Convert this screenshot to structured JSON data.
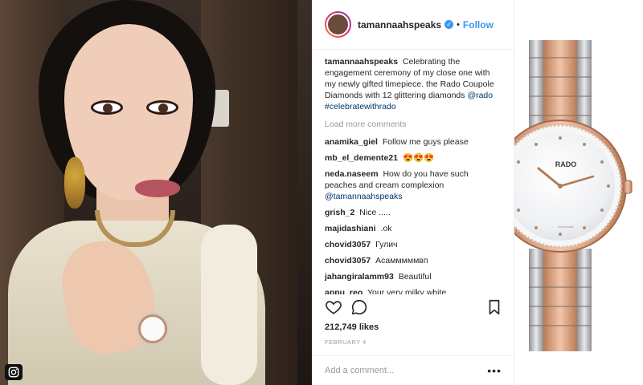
{
  "post": {
    "username": "tamannaahspeaks",
    "follow_label": "Follow",
    "caption": {
      "user": "tamannaahspeaks",
      "text": "Celebrating the engagement ceremony of my close one with my newly gifted timepiece. the Rado Coupole Diamonds with 12 glittering diamonds",
      "mention": "@rado",
      "hashtag": "#celebratewithrado"
    },
    "load_more": "Load more comments",
    "comments": [
      {
        "user": "anamika_giel",
        "text": "Follow me guys please"
      },
      {
        "user": "mb_el_demente21",
        "text": "😍😍😍"
      },
      {
        "user": "neda.naseem",
        "text": "How do you have such peaches and cream complexion",
        "mention": "@tamannaahspeaks"
      },
      {
        "user": "grish_2",
        "text": "Nice ....."
      },
      {
        "user": "majidashiani",
        "text": ".ok"
      },
      {
        "user": "chovid3057",
        "text": "Гулич"
      },
      {
        "user": "chovid3057",
        "text": "Асамммммвп"
      },
      {
        "user": "jahangiralamm93",
        "text": "Beautiful"
      },
      {
        "user": "appu_reo",
        "text": "Your very milky white"
      }
    ],
    "likes": "212,749 likes",
    "date": "FEBRUARY 4",
    "add_comment_placeholder": "Add a comment...",
    "more_label": "•••"
  },
  "product": {
    "brand": "RADO",
    "dial_small_text": "SWISS MADE"
  },
  "colors": {
    "link": "#003569",
    "follow": "#3897f0",
    "rose_gold": "#d6a07c",
    "steel": "#c8c9cc"
  }
}
